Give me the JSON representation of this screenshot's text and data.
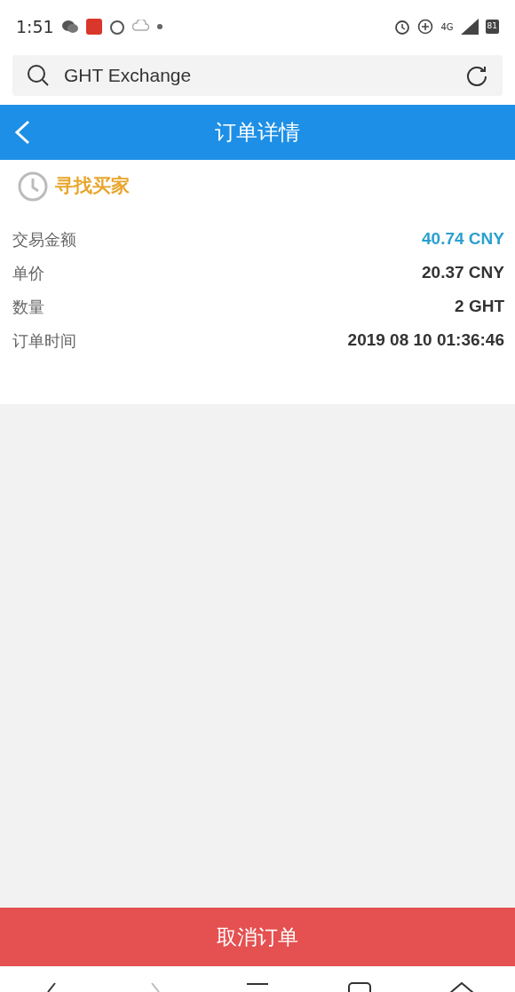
{
  "status_bar": {
    "time": "1:51",
    "battery": "81",
    "network": "4G"
  },
  "browser": {
    "address": "GHT Exchange"
  },
  "header": {
    "title": "订单详情"
  },
  "order_status": {
    "label": "寻找买家"
  },
  "details": [
    {
      "label": "交易金额",
      "value": "40.74 CNY",
      "highlight": true
    },
    {
      "label": "单价",
      "value": "20.37 CNY",
      "highlight": false
    },
    {
      "label": "数量",
      "value": "2 GHT",
      "highlight": false
    },
    {
      "label": "订单时间",
      "value": "2019 08 10 01:36:46",
      "highlight": false
    }
  ],
  "cancel_button": {
    "label": "取消订单"
  }
}
